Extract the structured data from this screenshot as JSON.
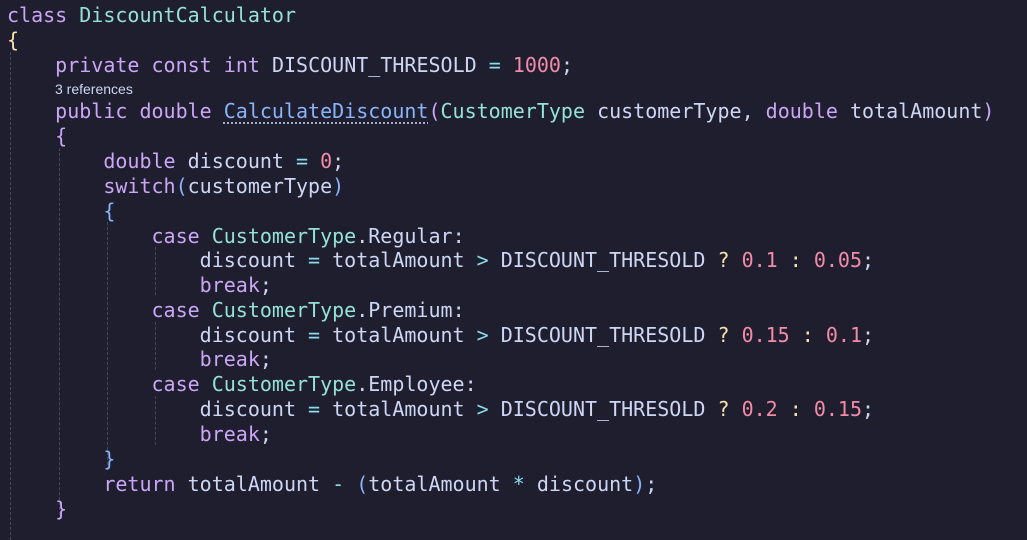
{
  "editor": {
    "codelens": "3 references",
    "lines": [
      [
        [
          "kw",
          "class"
        ],
        [
          "pl",
          " "
        ],
        [
          "ty",
          "DiscountCalculator"
        ]
      ],
      [
        [
          "br1",
          "{"
        ]
      ],
      [
        [
          "pl",
          "    "
        ],
        [
          "kw",
          "private"
        ],
        [
          "pl",
          " "
        ],
        [
          "kw",
          "const"
        ],
        [
          "pl",
          " "
        ],
        [
          "kw",
          "int"
        ],
        [
          "pl",
          " "
        ],
        [
          "id",
          "DISCOUNT_THRESOLD"
        ],
        [
          "pl",
          " "
        ],
        [
          "op",
          "="
        ],
        [
          "pl",
          " "
        ],
        [
          "nm2",
          "1000"
        ],
        [
          "pl",
          ";"
        ]
      ],
      [
        [
          "pl",
          "    "
        ],
        [
          "kw",
          "public"
        ],
        [
          "pl",
          " "
        ],
        [
          "kw",
          "double"
        ],
        [
          "pl",
          " "
        ],
        [
          "fn",
          "CalculateDiscount"
        ],
        [
          "br2",
          "("
        ],
        [
          "ty",
          "CustomerType"
        ],
        [
          "pl",
          " "
        ],
        [
          "id",
          "customerType"
        ],
        [
          "pl",
          ", "
        ],
        [
          "kw",
          "double"
        ],
        [
          "pl",
          " "
        ],
        [
          "id",
          "totalAmount"
        ],
        [
          "br2",
          ")"
        ]
      ],
      [
        [
          "pl",
          "    "
        ],
        [
          "br2",
          "{"
        ]
      ],
      [
        [
          "pl",
          "        "
        ],
        [
          "kw",
          "double"
        ],
        [
          "pl",
          " "
        ],
        [
          "id",
          "discount"
        ],
        [
          "pl",
          " "
        ],
        [
          "op",
          "="
        ],
        [
          "pl",
          " "
        ],
        [
          "nm2",
          "0"
        ],
        [
          "pl",
          ";"
        ]
      ],
      [
        [
          "pl",
          "        "
        ],
        [
          "kw",
          "switch"
        ],
        [
          "br3",
          "("
        ],
        [
          "id",
          "customerType"
        ],
        [
          "br3",
          ")"
        ]
      ],
      [
        [
          "pl",
          "        "
        ],
        [
          "br3",
          "{"
        ]
      ],
      [
        [
          "pl",
          "            "
        ],
        [
          "kw",
          "case"
        ],
        [
          "pl",
          " "
        ],
        [
          "ty",
          "CustomerType"
        ],
        [
          "pl",
          "."
        ],
        [
          "id",
          "Regular"
        ],
        [
          "pl",
          ":"
        ]
      ],
      [
        [
          "pl",
          "                "
        ],
        [
          "id",
          "discount"
        ],
        [
          "pl",
          " "
        ],
        [
          "op",
          "="
        ],
        [
          "pl",
          " "
        ],
        [
          "id",
          "totalAmount"
        ],
        [
          "pl",
          " "
        ],
        [
          "op",
          ">"
        ],
        [
          "pl",
          " "
        ],
        [
          "id",
          "DISCOUNT_THRESOLD"
        ],
        [
          "pl",
          " "
        ],
        [
          "tq",
          "?"
        ],
        [
          "pl",
          " "
        ],
        [
          "nm2",
          "0.1"
        ],
        [
          "pl",
          " "
        ],
        [
          "tq",
          ":"
        ],
        [
          "pl",
          " "
        ],
        [
          "nm2",
          "0.05"
        ],
        [
          "pl",
          ";"
        ]
      ],
      [
        [
          "pl",
          "                "
        ],
        [
          "kw",
          "break"
        ],
        [
          "pl",
          ";"
        ]
      ],
      [
        [
          "pl",
          "            "
        ],
        [
          "kw",
          "case"
        ],
        [
          "pl",
          " "
        ],
        [
          "ty",
          "CustomerType"
        ],
        [
          "pl",
          "."
        ],
        [
          "id",
          "Premium"
        ],
        [
          "pl",
          ":"
        ]
      ],
      [
        [
          "pl",
          "                "
        ],
        [
          "id",
          "discount"
        ],
        [
          "pl",
          " "
        ],
        [
          "op",
          "="
        ],
        [
          "pl",
          " "
        ],
        [
          "id",
          "totalAmount"
        ],
        [
          "pl",
          " "
        ],
        [
          "op",
          ">"
        ],
        [
          "pl",
          " "
        ],
        [
          "id",
          "DISCOUNT_THRESOLD"
        ],
        [
          "pl",
          " "
        ],
        [
          "tq",
          "?"
        ],
        [
          "pl",
          " "
        ],
        [
          "nm2",
          "0.15"
        ],
        [
          "pl",
          " "
        ],
        [
          "tq",
          ":"
        ],
        [
          "pl",
          " "
        ],
        [
          "nm2",
          "0.1"
        ],
        [
          "pl",
          ";"
        ]
      ],
      [
        [
          "pl",
          "                "
        ],
        [
          "kw",
          "break"
        ],
        [
          "pl",
          ";"
        ]
      ],
      [
        [
          "pl",
          "            "
        ],
        [
          "kw",
          "case"
        ],
        [
          "pl",
          " "
        ],
        [
          "ty",
          "CustomerType"
        ],
        [
          "pl",
          "."
        ],
        [
          "id",
          "Employee"
        ],
        [
          "pl",
          ":"
        ]
      ],
      [
        [
          "pl",
          "                "
        ],
        [
          "id",
          "discount"
        ],
        [
          "pl",
          " "
        ],
        [
          "op",
          "="
        ],
        [
          "pl",
          " "
        ],
        [
          "id",
          "totalAmount"
        ],
        [
          "pl",
          " "
        ],
        [
          "op",
          ">"
        ],
        [
          "pl",
          " "
        ],
        [
          "id",
          "DISCOUNT_THRESOLD"
        ],
        [
          "pl",
          " "
        ],
        [
          "tq",
          "?"
        ],
        [
          "pl",
          " "
        ],
        [
          "nm2",
          "0.2"
        ],
        [
          "pl",
          " "
        ],
        [
          "tq",
          ":"
        ],
        [
          "pl",
          " "
        ],
        [
          "nm2",
          "0.15"
        ],
        [
          "pl",
          ";"
        ]
      ],
      [
        [
          "pl",
          "                "
        ],
        [
          "kw",
          "break"
        ],
        [
          "pl",
          ";"
        ]
      ],
      [
        [
          "pl",
          "        "
        ],
        [
          "br3",
          "}"
        ]
      ],
      [
        [
          "pl",
          "        "
        ],
        [
          "kw",
          "return"
        ],
        [
          "pl",
          " "
        ],
        [
          "id",
          "totalAmount"
        ],
        [
          "pl",
          " "
        ],
        [
          "op",
          "-"
        ],
        [
          "pl",
          " "
        ],
        [
          "br3",
          "("
        ],
        [
          "id",
          "totalAmount"
        ],
        [
          "pl",
          " "
        ],
        [
          "op",
          "*"
        ],
        [
          "pl",
          " "
        ],
        [
          "id",
          "discount"
        ],
        [
          "br3",
          ")"
        ],
        [
          "pl",
          ";"
        ]
      ],
      [
        [
          "pl",
          "    "
        ],
        [
          "br2",
          "}"
        ]
      ]
    ]
  }
}
